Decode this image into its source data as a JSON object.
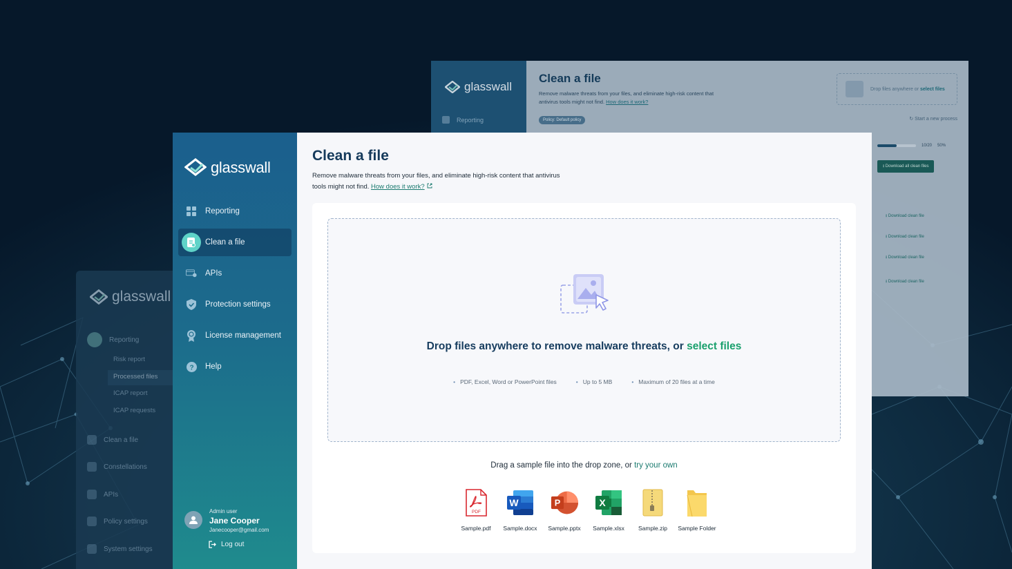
{
  "brand": {
    "logo_text": "glasswall"
  },
  "back_right": {
    "title": "Clean a file",
    "desc_text": "Remove malware threats from your files, and eliminate high-risk content that antivirus tools might not find.",
    "how_link": "How does it work?",
    "nav_item": "Reporting",
    "policy_badge": "Policy: Default policy",
    "drop_text": "Drop files anywhere or",
    "drop_select": "select files",
    "new_process": "Start a new process",
    "progress_count": "10/20",
    "progress_percent": "50%",
    "progress_fraction": 0.5,
    "download_all": "Download all clean files",
    "download_items": [
      "Download clean file",
      "Download clean file",
      "Download clean file",
      "Download clean file"
    ]
  },
  "back_left": {
    "nav": [
      "Reporting",
      "Clean a file",
      "Constellations",
      "APIs",
      "Policy settings",
      "System settings"
    ],
    "sub": [
      "Risk report",
      "Processed files",
      "ICAP report",
      "ICAP requests"
    ]
  },
  "sidebar": {
    "items": [
      {
        "label": "Reporting",
        "icon": "grid-icon"
      },
      {
        "label": "Clean a file",
        "icon": "clean-file-icon"
      },
      {
        "label": "APIs",
        "icon": "api-card-icon"
      },
      {
        "label": "Protection settings",
        "icon": "shield-icon"
      },
      {
        "label": "License management",
        "icon": "badge-icon"
      },
      {
        "label": "Help",
        "icon": "help-icon"
      }
    ],
    "active_index": 1,
    "user": {
      "role": "Admin user",
      "name": "Jane Cooper",
      "email": "Janecooper@gmail.com"
    },
    "logout": "Log out"
  },
  "main": {
    "title": "Clean a file",
    "desc_text": "Remove malware threats from your files, and eliminate high-risk content that antivirus tools might not find.",
    "how_link": "How does it work?",
    "dropzone": {
      "text": "Drop files anywhere to remove malware threats, or",
      "select": "select files",
      "bullets": [
        "PDF, Excel, Word or PowerPoint files",
        "Up to 5 MB",
        "Maximum of 20 files at a time"
      ]
    },
    "sample_text": "Drag a sample file into the drop zone, or",
    "sample_link": "try your own",
    "samples": [
      {
        "name": "Sample.pdf",
        "icon": "pdf-icon"
      },
      {
        "name": "Sample.docx",
        "icon": "word-icon"
      },
      {
        "name": "Sample.pptx",
        "icon": "powerpoint-icon"
      },
      {
        "name": "Sample.xlsx",
        "icon": "excel-icon"
      },
      {
        "name": "Sample.zip",
        "icon": "zip-icon"
      },
      {
        "name": "Sample Folder",
        "icon": "folder-icon"
      }
    ]
  },
  "colors": {
    "accent": "#1aa06d",
    "brand_dark": "#153a5b",
    "sidebar_top": "#1b5f8d",
    "sidebar_bottom": "#1f8b8d"
  }
}
